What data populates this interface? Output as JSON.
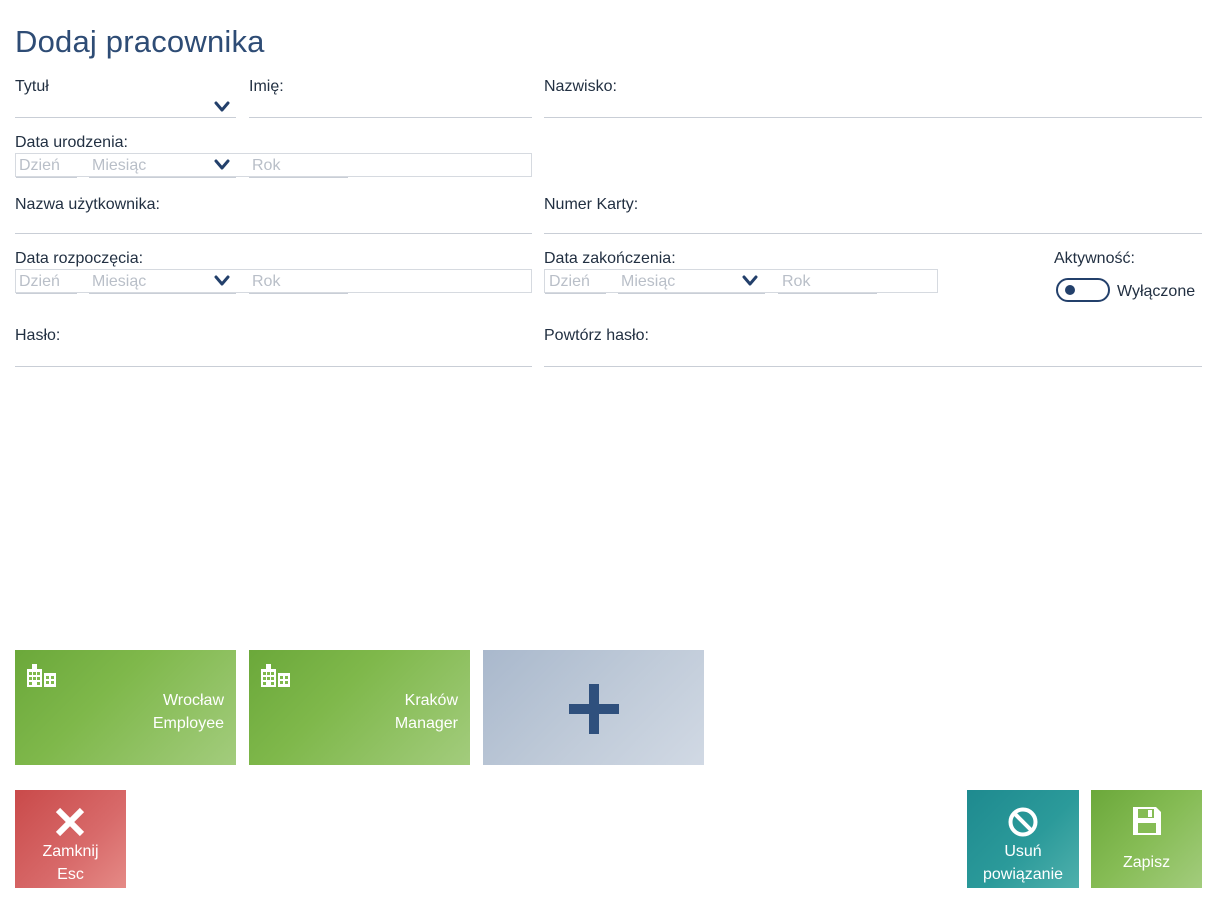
{
  "page": {
    "title": "Dodaj pracownika"
  },
  "form": {
    "title_label": "Tytuł",
    "first_name_label": "Imię:",
    "last_name_label": "Nazwisko:",
    "birth_date_label": "Data urodzenia:",
    "username_label": "Nazwa użytkownika:",
    "card_number_label": "Numer Karty:",
    "start_date_label": "Data rozpoczęcia:",
    "end_date_label": "Data zakończenia:",
    "activity_label": "Aktywność:",
    "activity_state": "Wyłączone",
    "password_label": "Hasło:",
    "repeat_password_label": "Powtórz hasło:",
    "date_placeholders": {
      "day": "Dzień",
      "month": "Miesiąc",
      "year": "Rok"
    }
  },
  "tiles": [
    {
      "line1": "Wrocław",
      "line2": "Employee",
      "icon": "building-icon"
    },
    {
      "line1": "Kraków",
      "line2": "Manager",
      "icon": "building-icon"
    }
  ],
  "add_tile": {
    "icon": "plus-icon"
  },
  "buttons": {
    "close": {
      "line1": "Zamknij",
      "line2": "Esc",
      "icon": "close-icon"
    },
    "unlink": {
      "line1": "Usuń",
      "line2": "powiązanie",
      "icon": "ban-icon"
    },
    "save": {
      "label": "Zapisz",
      "icon": "save-icon"
    }
  },
  "colors": {
    "title": "#2e4c75",
    "tile_green": "#7fb84b",
    "tile_add": "#c0cbd9",
    "close_red": "#d86a6a",
    "unlink_teal": "#2b9a9a",
    "save_green": "#86bc55"
  }
}
